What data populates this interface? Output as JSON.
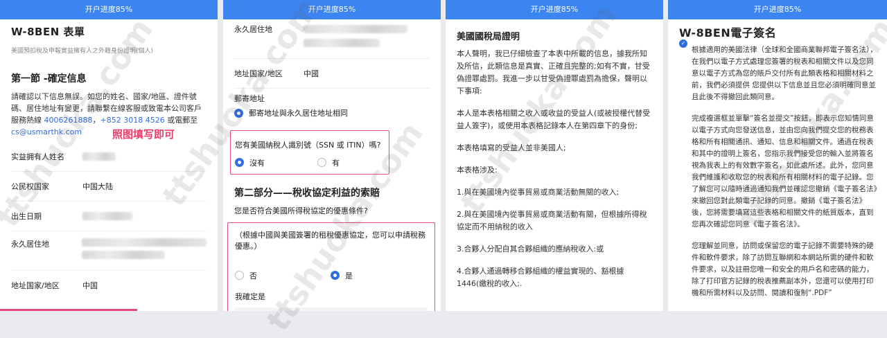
{
  "progress_label": "开户进度85%",
  "panel1": {
    "title": "W-8BEN 表單",
    "subtitle": "美國預扣稅及申報實益擁有人之外籍身份證明(個人)",
    "section_title": "第一節 -確定信息",
    "para": "請確認以下信息無誤。如您的姓名、國家/地區、證件號碼、居住地址有變更，請聯繫在線客服或致電本公司客戶服務熱線",
    "phone1": "4006261888",
    "phone_sep": "，",
    "phone2": "+852 3018 4526",
    "para_tail": "或電郵至",
    "email": "cs@usmarthk.com",
    "annotation": "照图填写即可",
    "rows": [
      {
        "label": "实益拥有人姓名"
      },
      {
        "label": "公民权国家",
        "value": "中国大陆"
      },
      {
        "label": "出生日期"
      },
      {
        "label": "永久居住地"
      },
      {
        "label": "地址国家/地区",
        "value": "中国"
      }
    ]
  },
  "panel2": {
    "residence_label": "永久居住地",
    "country_label": "地址国家/地区",
    "country_value": "中國",
    "mailing_label": "郵寄地址",
    "mailing_option": "郵寄地址與永久居住地址相同",
    "tin_question": "您有美國納稅人識別號（SSN 或 ITIN）嗎?",
    "tin_no": "沒有",
    "tin_yes": "有",
    "section2_title": "第二部分——稅收協定利益的索賠",
    "treaty_question": "您是否符合美國所得稅協定的優惠條件?",
    "treaty_text": "（根據中國與美國簽署的租稅優惠協定，您可以申請稅務優惠。）",
    "treaty_no": "否",
    "treaty_yes": "是",
    "confirm_label": "我確定是"
  },
  "panel3": {
    "title": "美國國稅局證明",
    "p1": "本人聲明，我已仔細檢查了本表中所載的信息，據我所知及所信，此類信息是真實、正確且完整的;如有不實，甘受偽證罪處罰。我進一步以甘受偽證罪處罰為擔保，聲明以下事項:",
    "p2": "本人是本表格相關之收入或收益的受益人(或被授權代替受益人簽字)，或使用本表格記錄本人在第四章下的身份;",
    "p3": "本表格填寫的受益人並非美國人;",
    "p4": "本表格涉及:",
    "p5": "1.與在美國境內從事貿易或商業活動無關的收入;",
    "p6": "2.與在美國境內從事貿易或商業活動有關，但根據所得稅協定而不用納稅的收入",
    "p7": "3.合夥人分配自其合夥組織的應納稅收入:或",
    "p8": "4.合夥人通過轉移合夥組織的權益實現的、豁根據1446(繳稅的收入;."
  },
  "panel4": {
    "title": "W-8BEN電子簽名",
    "p1": "根據適用的美國法律（全球和全國商業聯邦電子簽名法），在我們以電子方式處理您簽署的稅表和相關文件以及您同意以電子方式為您的賬戶交付所有此類表格和相關材料之前，我們必須提供 您提供以下信息並且您必須明確同意並且此後不得撤回此類同意。",
    "p2": "完成複選框並單擊“簽名並提交”按鈕，即表示您知情同意以電子方式向您發送信息，並由您向我們提交您的稅務表格和所有相關通訊、通知、信息和相關文件。通過在稅表和其中的證明上簽名，您指示我們接受您的輸入並將簽名視為我表上的有效數字簽名，如此處所述。此外，您同意我們維護和收取您的稅表和所有相關材料的電子記錄。您了解您可以隨時通過通知我們並確認您撤銷《電子簽名法》來撤回您對此類電子記錄的同意。撤銷《電子簽名法》後，您將需要填寫這些表格和相關文件的紙質版本，直到您再次確認您同意《電子簽名法》。",
    "p3": "您理解並同意，訪問或保留您的電子記錄不需要特殊的硬件和軟件要求，除了訪問互聯網和本網站所需的硬件和軟件要求，以及註冊您唯一和安全的用戶名和密碼的能力，除了打印官方記錄的稅表推薦副本外，您還可以使用打印機和所需材料以及訪問、閱讀和復制“.PDF”"
  },
  "watermarks": [
    "ttshuoka.com",
    "ttshuoka.com",
    "ttshuoka.com",
    "ttshuoka.com",
    "ttshuoka.com"
  ]
}
